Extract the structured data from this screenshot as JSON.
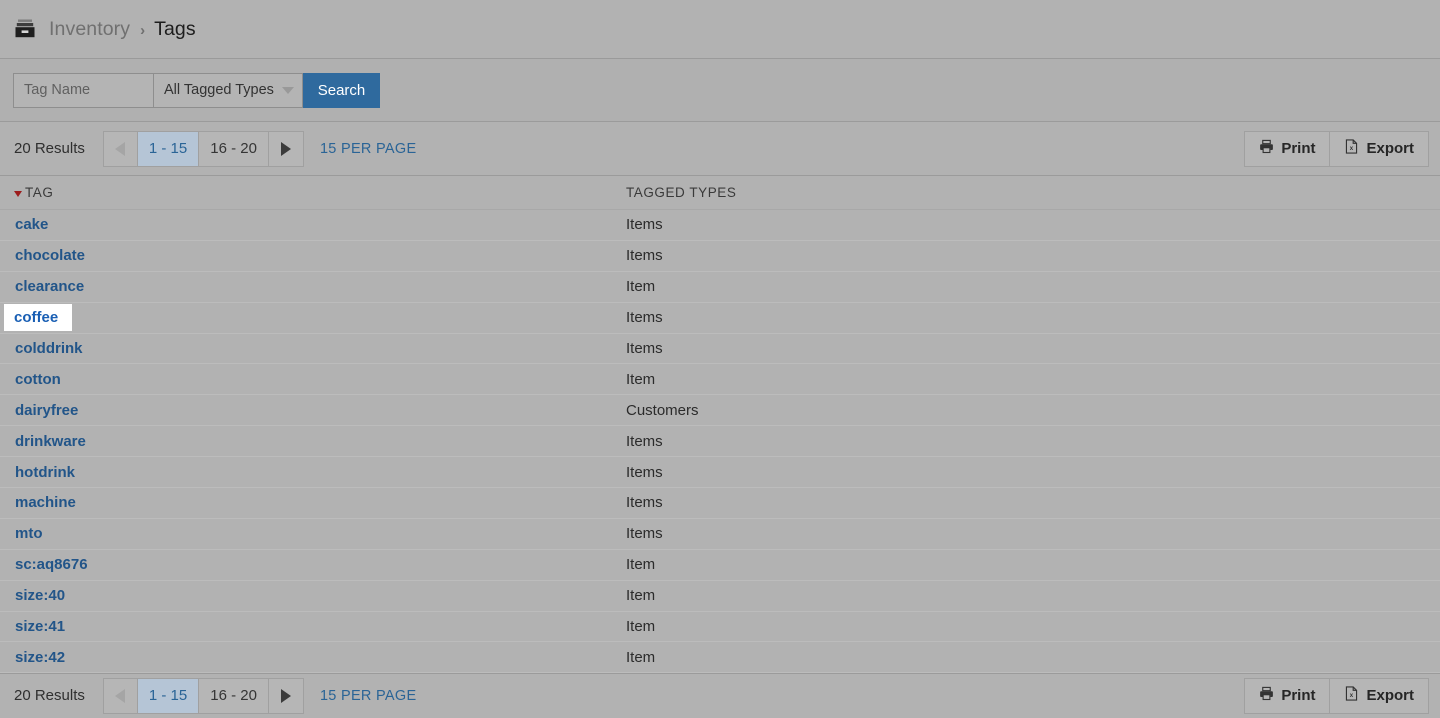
{
  "breadcrumb": {
    "icon": "archive-box-icon",
    "parent": "Inventory",
    "separator": "›",
    "current": "Tags"
  },
  "search": {
    "tag_name_placeholder": "Tag Name",
    "tag_name_value": "",
    "tagged_types_selected": "All Tagged Types",
    "tagged_types_options": [
      "All Tagged Types"
    ],
    "search_button": "Search",
    "dropdown_icon": "chevron-down-icon"
  },
  "toolbar": {
    "results": "20 Results",
    "prev_icon": "triangle-left-icon",
    "next_icon": "triangle-right-icon",
    "pages": [
      {
        "label": "1 - 15",
        "active": true
      },
      {
        "label": "16 - 20",
        "active": false
      }
    ],
    "per_page": "15 PER PAGE",
    "print_label": "Print",
    "print_icon": "printer-icon",
    "export_label": "Export",
    "export_icon": "excel-document-icon"
  },
  "table": {
    "sort_icon": "sort-desc-caret-icon",
    "columns": [
      "TAG",
      "TAGGED TYPES"
    ],
    "rows": [
      {
        "tag": "cake",
        "types": "Items",
        "focused": false
      },
      {
        "tag": "chocolate",
        "types": "Items",
        "focused": false
      },
      {
        "tag": "clearance",
        "types": "Item",
        "focused": false
      },
      {
        "tag": "coffee",
        "types": "Items",
        "focused": true
      },
      {
        "tag": "colddrink",
        "types": "Items",
        "focused": false
      },
      {
        "tag": "cotton",
        "types": "Item",
        "focused": false
      },
      {
        "tag": "dairyfree",
        "types": "Customers",
        "focused": false
      },
      {
        "tag": "drinkware",
        "types": "Items",
        "focused": false
      },
      {
        "tag": "hotdrink",
        "types": "Items",
        "focused": false
      },
      {
        "tag": "machine",
        "types": "Items",
        "focused": false
      },
      {
        "tag": "mto",
        "types": "Items",
        "focused": false
      },
      {
        "tag": "sc:aq8676",
        "types": "Item",
        "focused": false
      },
      {
        "tag": "size:40",
        "types": "Item",
        "focused": false
      },
      {
        "tag": "size:41",
        "types": "Item",
        "focused": false
      },
      {
        "tag": "size:42",
        "types": "Item",
        "focused": false
      }
    ]
  },
  "colors": {
    "page_background": "#b2b2b2",
    "accent_blue": "#2f6a9e",
    "link_blue": "#225589",
    "active_page": "#b5c5d6",
    "sort_caret_red": "#9c1c1c",
    "focus_highlight": "#ffffff"
  }
}
